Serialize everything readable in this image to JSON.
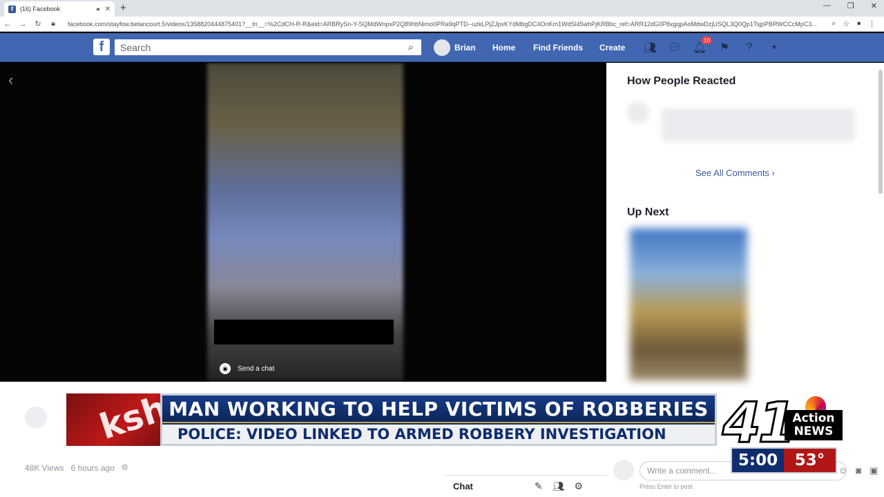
{
  "browser": {
    "tab_title": "(16) Facebook",
    "tab_favicon": "f",
    "tab_close": "✕",
    "new_tab": "+",
    "url": "facebook.com/stayfow.betancourt.5/videos/1358820444875401?__tn__=%2CdCH-R-R&eid=ARBRySn-Y-SQMdWnpxP2Q89hbNimo0PRa9qPTD--uzkLPjZJpvKYdMbgDC4OnKm1WdSl45whPjKRBbc_ref=ARR12dG0P8xgqpAoMdwDzjUSQL3Q0Qp1TsjpPBRWCCcMpC3..."
  },
  "fb": {
    "logo": "f",
    "search_placeholder": "Search",
    "user_name": "Brian",
    "nav": [
      "Home",
      "Find Friends",
      "Create"
    ],
    "notifications_count": "16"
  },
  "video": {
    "send_chat": "Send a chat"
  },
  "panel": {
    "reactions_title": "How People Reacted",
    "see_all": "See All Comments",
    "up_next_title": "Up Next"
  },
  "post": {
    "views": "48K Views",
    "time": "6 hours ago"
  },
  "chat": {
    "label": "Chat"
  },
  "comment": {
    "placeholder": "Write a comment...",
    "hint": "Press Enter to post."
  },
  "news": {
    "headline": "MAN WORKING TO HELP VICTIMS OF ROBBERIES",
    "subhead": "POLICE: VIDEO LINKED TO ARMED ROBBERY INVESTIGATION",
    "logo_text": "ksh",
    "station_number": "41",
    "station_name_1": "Action",
    "station_name_2": "NEWS",
    "time": "5:00",
    "temperature": "53°"
  },
  "colors": {
    "facebook_blue": "#4267b2",
    "headline_blue": "#0f2d6e",
    "news_red": "#b01717"
  }
}
